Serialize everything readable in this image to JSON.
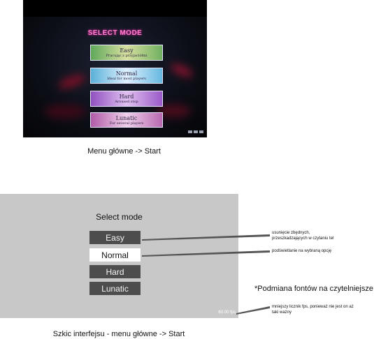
{
  "screenshot": {
    "title": "SELECT MODE",
    "buttons": [
      {
        "label": "Easy",
        "sub": "Pracując z przyjaciółmi"
      },
      {
        "label": "Normal",
        "sub": "Ideal for most players"
      },
      {
        "label": "Hard",
        "sub": "Aroused stop"
      },
      {
        "label": "Lunatic",
        "sub": "For several players"
      }
    ]
  },
  "caption_top": "Menu główne -> Start",
  "mockup": {
    "title": "Select mode",
    "buttons": [
      {
        "label": "Easy"
      },
      {
        "label": "Normal"
      },
      {
        "label": "Hard"
      },
      {
        "label": "Lunatic"
      }
    ],
    "fps": "60.00 fps"
  },
  "notes": {
    "remove": "usunięcie zbędnych, przeszkadzających w czytaniu tel",
    "highlight": "podświetlanie na wybraną opcję",
    "fonts": "*Podmiana fontów na czytelniejsze",
    "fps_counter": "mniejszy licznik fps, ponieważ nie jest on aż taki ważny"
  },
  "caption_bottom": "Szkic interfejsu - menu główne -> Start"
}
